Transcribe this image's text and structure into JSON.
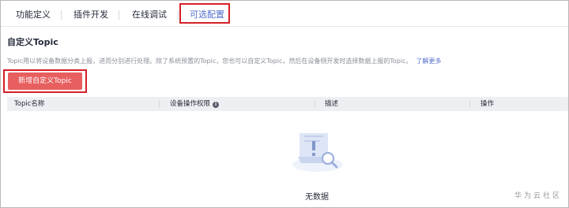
{
  "tabs": [
    {
      "label": "功能定义"
    },
    {
      "label": "插件开发"
    },
    {
      "label": "在线调试"
    },
    {
      "label": "可选配置",
      "active": true
    }
  ],
  "section": {
    "title": "自定义Topic",
    "description": "Topic用以将设备数据分类上报，进而分别进行处理。除了系统预置的Topic，您也可以自定义Topic，然后在设备侧开发时选择数据上报的Topic。",
    "learn_more": "了解更多",
    "add_button": "新增自定义Topic"
  },
  "table": {
    "columns": [
      "Topic名称",
      "设备操作权限",
      "描述",
      "操作"
    ],
    "empty_text": "无数据"
  },
  "watermark": "华为云社区",
  "colors": {
    "accent": "#526ecc",
    "primary_button": "#e75f5f",
    "highlight_box": "#d42028"
  },
  "icons": [
    "info-icon",
    "empty-data-icon"
  ]
}
